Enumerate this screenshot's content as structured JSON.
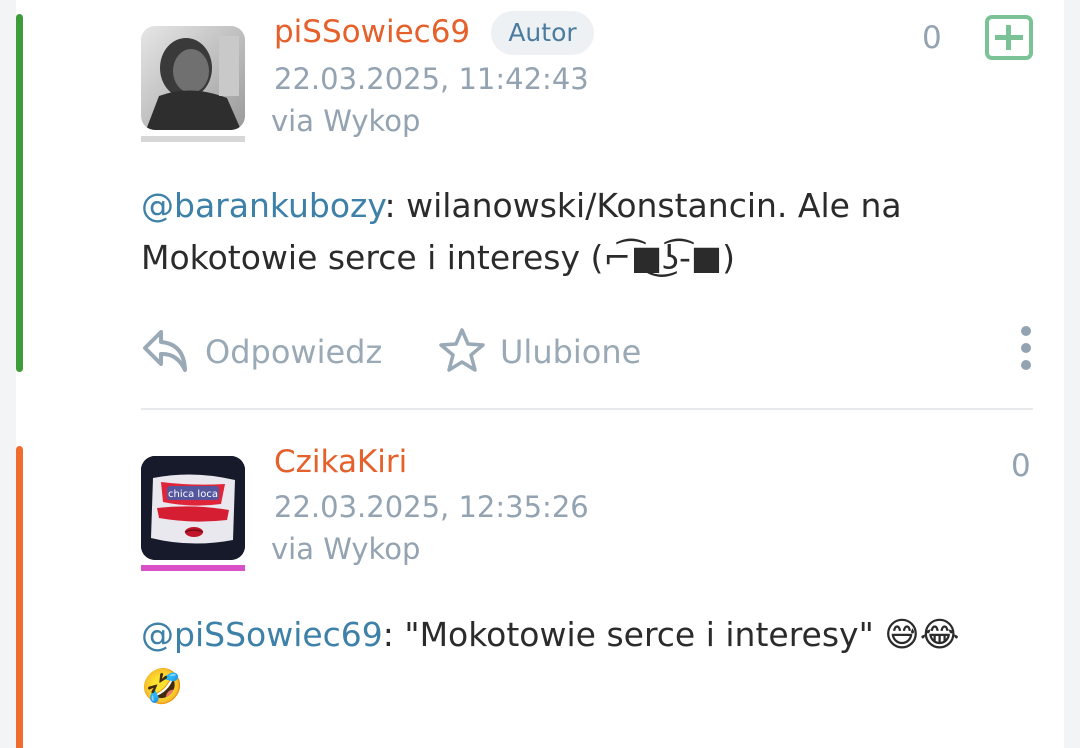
{
  "colors": {
    "accent_green": "#3d9b3a",
    "accent_orange": "#ef6c2e",
    "username": "#e5602a",
    "mention": "#3d80a8",
    "muted": "#93a3b1",
    "plus_button": "#7bc397",
    "second_avatar_underline": "#d94fc6"
  },
  "comments": [
    {
      "username": "piSSowiec69",
      "badge": "Autor",
      "timestamp": "22.03.2025, 11:42:43",
      "via": "via Wykop",
      "votes": "0",
      "mention": "@barankubozy",
      "text_after_mention": ": wilanowski/Konstancin. Ale na Mokotowie serce i interesy (⌐͡■͜ʖ͡-■)",
      "actions": {
        "reply": "Odpowiedz",
        "favorite": "Ulubione"
      }
    },
    {
      "username": "CzikaKiri",
      "timestamp": "22.03.2025, 12:35:26",
      "via": "via Wykop",
      "votes": "0",
      "mention": "@piSSowiec69",
      "text_after_mention": ": \"Mokotowie serce i interesy\" ",
      "emojis": "😅😂🤣",
      "avatar_text": "chica loca"
    }
  ]
}
